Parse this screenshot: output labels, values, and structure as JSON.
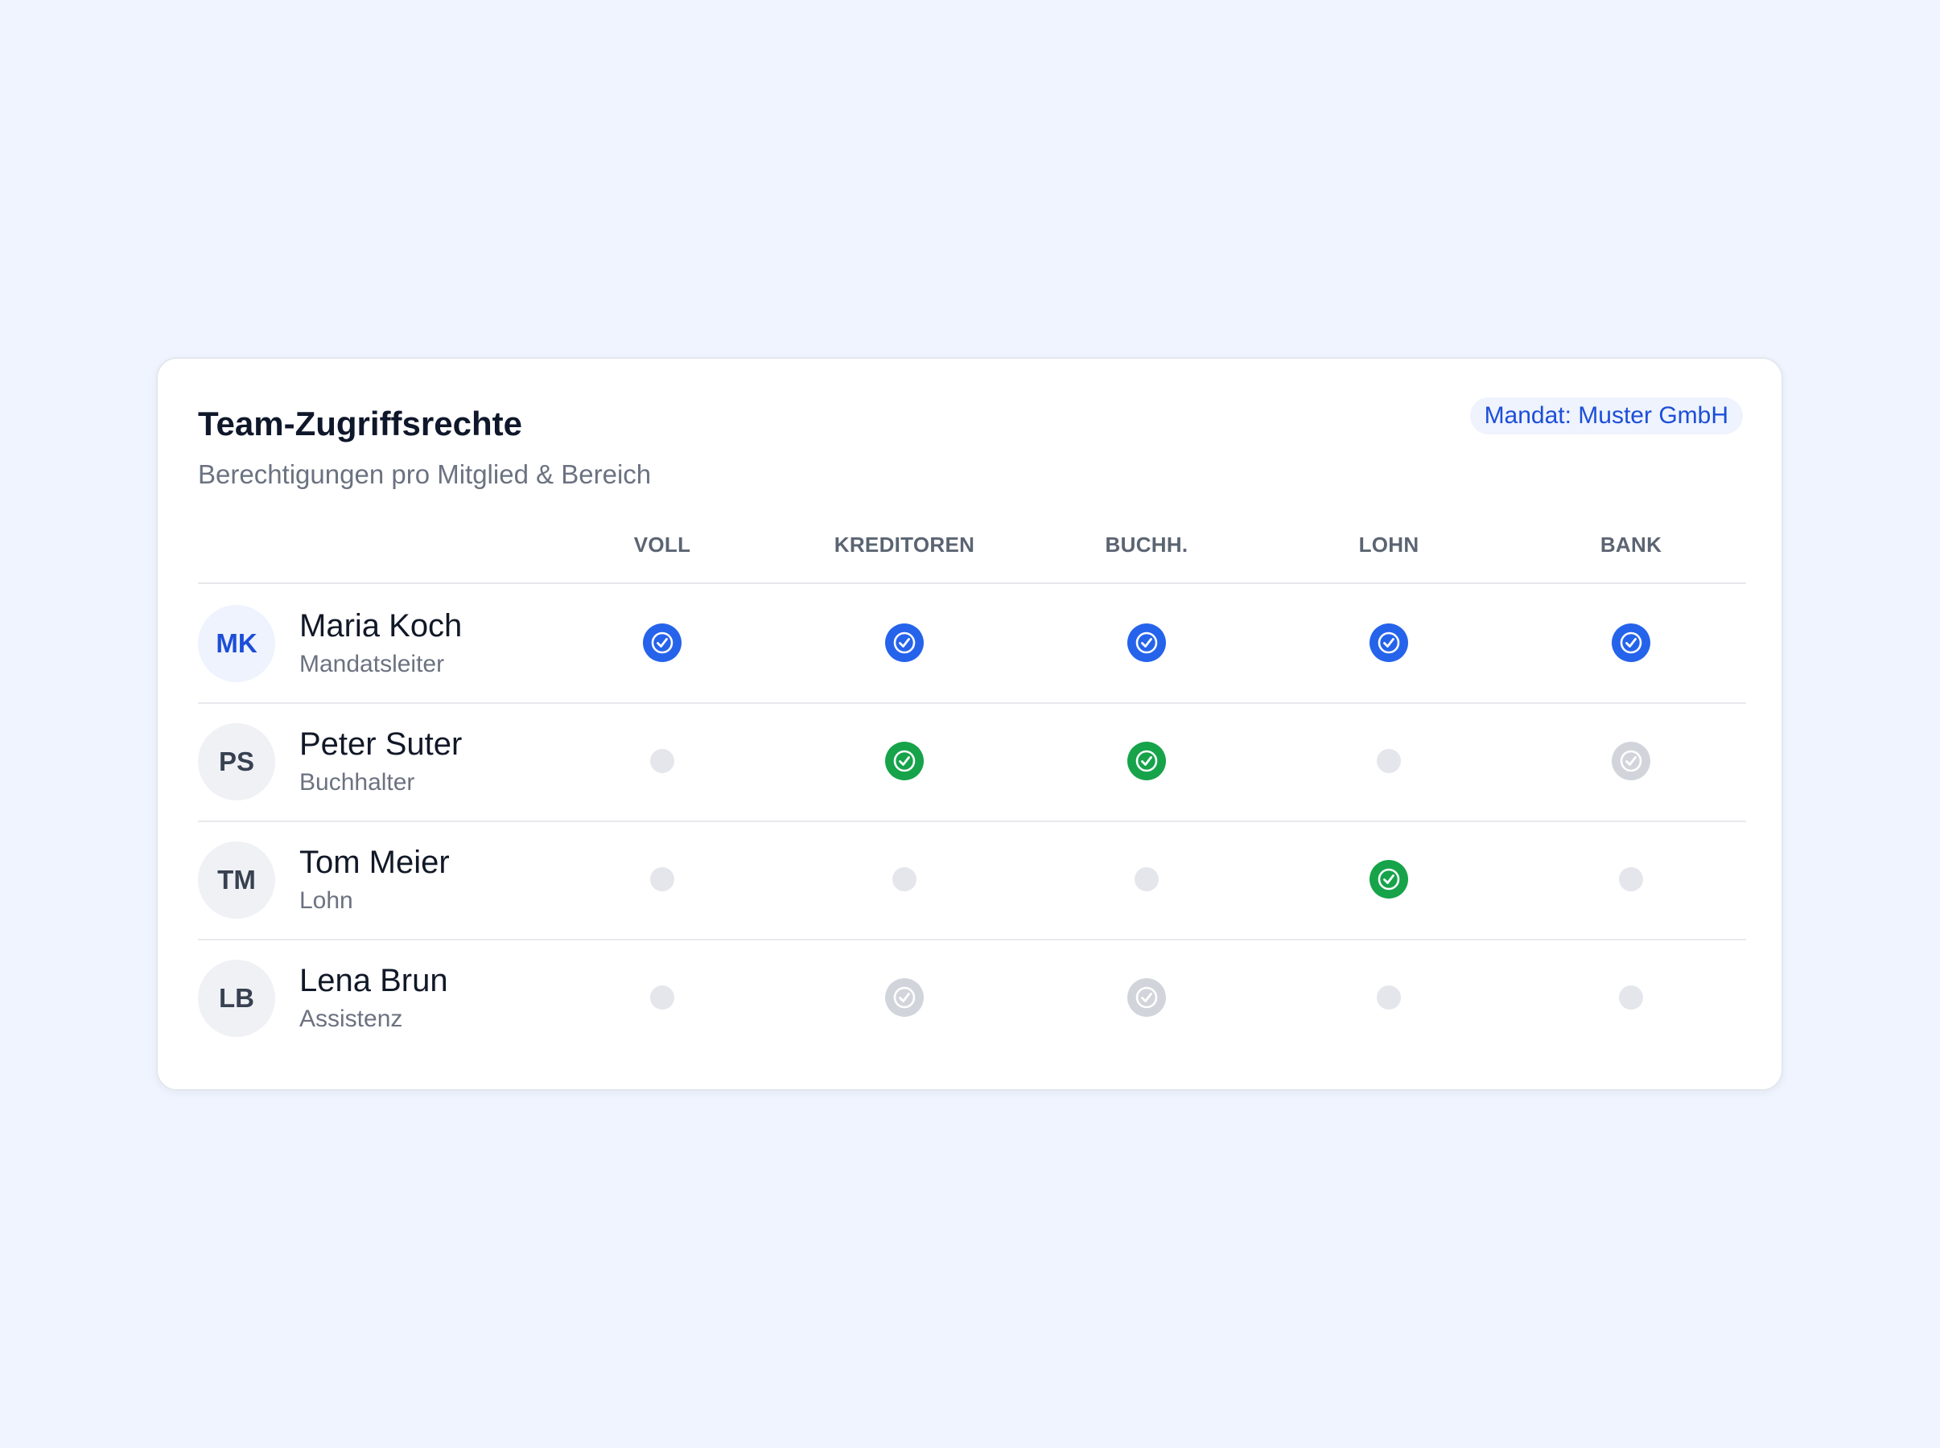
{
  "card": {
    "title": "Team-Zugriffsrechte",
    "subtitle": "Berechtigungen pro Mitglied & Bereich",
    "badge": "Mandat: Muster GmbH"
  },
  "columns": [
    "VOLL",
    "KREDITOREN",
    "BUCHH.",
    "LOHN",
    "BANK"
  ],
  "status_colors": {
    "full": "#2563eb",
    "granted": "#16a34a",
    "inactive": "#d1d5db",
    "none": "#e4e6ec"
  },
  "members": [
    {
      "initials": "MK",
      "name": "Maria Koch",
      "role": "Mandatsleiter",
      "avatar_style": "primary",
      "permissions": [
        "full",
        "full",
        "full",
        "full",
        "full"
      ]
    },
    {
      "initials": "PS",
      "name": "Peter Suter",
      "role": "Buchhalter",
      "avatar_style": "neutral",
      "permissions": [
        "none",
        "granted",
        "granted",
        "none",
        "inactive"
      ]
    },
    {
      "initials": "TM",
      "name": "Tom Meier",
      "role": "Lohn",
      "avatar_style": "neutral",
      "permissions": [
        "none",
        "none",
        "none",
        "granted",
        "none"
      ]
    },
    {
      "initials": "LB",
      "name": "Lena Brun",
      "role": "Assistenz",
      "avatar_style": "neutral",
      "permissions": [
        "none",
        "inactive",
        "inactive",
        "none",
        "none"
      ]
    }
  ]
}
